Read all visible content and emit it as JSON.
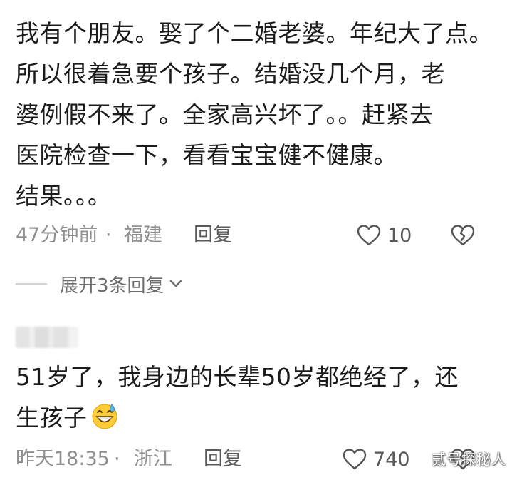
{
  "comment1": {
    "lines": [
      "我有个朋友。娶了个二婚老婆。年纪大了点。",
      "所以很着急要个孩子。结婚没几个月，老",
      "婆例假不来了。全家高兴坏了。。赶紧去",
      "医院检查一下，看看宝宝健不健康。",
      "结果。。。"
    ],
    "time": "47分钟前",
    "dot": "·",
    "location": "福建",
    "reply_label": "回复",
    "like_count": "10"
  },
  "expand_label": "展开3条回复",
  "comment2": {
    "lines": [
      "51岁了，我身边的长辈50岁都绝经了，还",
      "生孩子"
    ],
    "emoji": "grinning-sweat-emoji",
    "time": "昨天18:35",
    "dot": "·",
    "location": "浙江",
    "reply_label": "回复",
    "like_count": "740"
  },
  "watermark": "贰号探秘人",
  "colors": {
    "text": "#1b1b1b",
    "meta": "#8f8f8f",
    "action": "#5a5a5a"
  },
  "icons": {
    "like": "heart-outline-icon",
    "dislike": "broken-heart-icon",
    "expand": "chevron-down-icon"
  }
}
